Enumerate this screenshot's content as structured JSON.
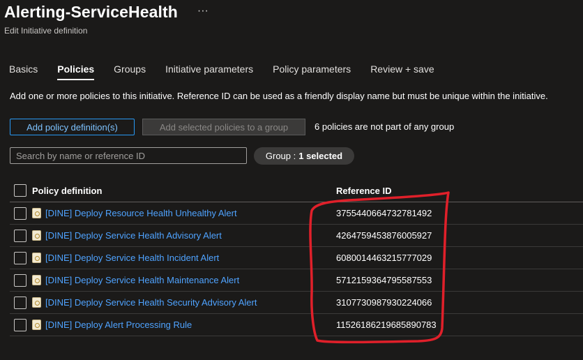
{
  "header": {
    "title": "Alerting-ServiceHealth",
    "more": "···",
    "subtitle": "Edit Initiative definition"
  },
  "tabs": [
    {
      "label": "Basics",
      "active": false
    },
    {
      "label": "Policies",
      "active": true
    },
    {
      "label": "Groups",
      "active": false
    },
    {
      "label": "Initiative parameters",
      "active": false
    },
    {
      "label": "Policy parameters",
      "active": false
    },
    {
      "label": "Review + save",
      "active": false
    }
  ],
  "description": "Add one or more policies to this initiative. Reference ID can be used as a friendly display name but must be unique within the initiative.",
  "toolbar": {
    "add_policy_label": "Add policy definition(s)",
    "add_to_group_label": "Add selected policies to a group",
    "group_note": "6 policies are not part of any group"
  },
  "search": {
    "placeholder": "Search by name or reference ID",
    "value": ""
  },
  "filter": {
    "label": "Group :",
    "value": "1 selected"
  },
  "table": {
    "columns": [
      "Policy definition",
      "Reference ID"
    ],
    "rows": [
      {
        "policy": "[DINE] Deploy Resource Health Unhealthy Alert",
        "ref_id": "3755440664732781492"
      },
      {
        "policy": "[DINE] Deploy Service Health Advisory Alert",
        "ref_id": "4264759453876005927"
      },
      {
        "policy": "[DINE] Deploy Service Health Incident Alert",
        "ref_id": "6080014463215777029"
      },
      {
        "policy": "[DINE] Deploy Service Health Maintenance Alert",
        "ref_id": "5712159364795587553"
      },
      {
        "policy": "[DINE] Deploy Service Health Security Advisory Alert",
        "ref_id": "3107730987930224066"
      },
      {
        "policy": "[DINE] Deploy Alert Processing Rule",
        "ref_id": "11526186219685890783"
      }
    ]
  },
  "annotation": {
    "color": "#e0202a"
  }
}
